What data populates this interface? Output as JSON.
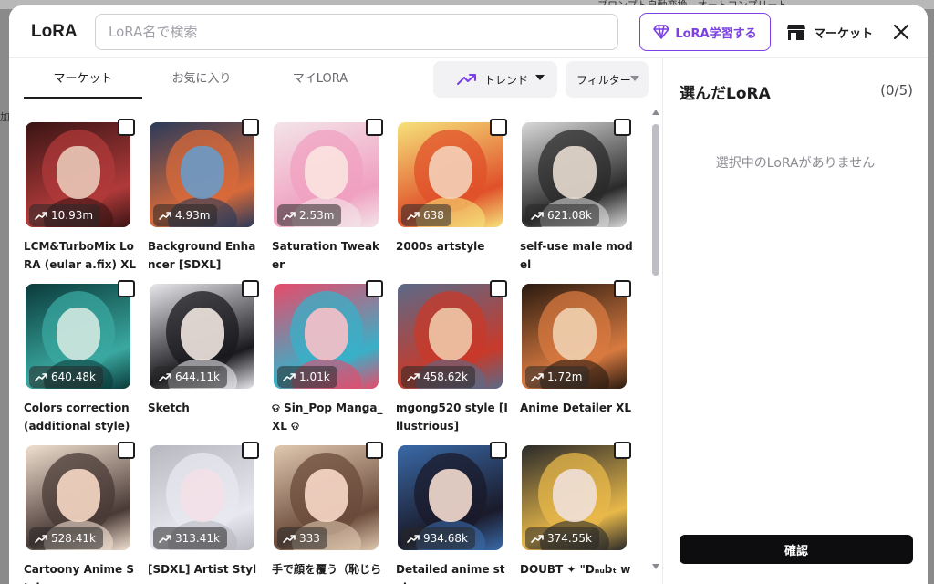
{
  "background": {
    "top_text": "プロンプト自動変換　オートコンプリート",
    "left_text": "加"
  },
  "header": {
    "title": "LoRA",
    "search_placeholder": "LoRA名で検索",
    "train_label": "LoRA学習する",
    "market_label": "マーケット",
    "accent_color": "#7b3fe4"
  },
  "tabs": [
    {
      "label": "マーケット",
      "active": true
    },
    {
      "label": "お気に入り",
      "active": false
    },
    {
      "label": "マイLORA",
      "active": false
    }
  ],
  "sort": {
    "label": "トレンド",
    "icon": "trending-up-icon"
  },
  "filter": {
    "label": "フィルター"
  },
  "cards": [
    {
      "name": "LCM&TurboMix LoRA (eular a.fix) XL",
      "count": "10.93m",
      "colors": [
        "#3a1414",
        "#b03a3a",
        "#e8c8b8"
      ]
    },
    {
      "name": "Background Enhancer [SDXL]",
      "count": "4.93m",
      "colors": [
        "#2a3a5a",
        "#d86a3a",
        "#6a9ac8"
      ]
    },
    {
      "name": "Saturation Tweaker",
      "count": "2.53m",
      "colors": [
        "#f3e4e8",
        "#f0a0c0",
        "#fbe4e0"
      ]
    },
    {
      "name": "2000s artstyle",
      "count": "638",
      "colors": [
        "#f6e27a",
        "#e0502a",
        "#f4d0b8"
      ]
    },
    {
      "name": "self-use male model",
      "count": "621.08k",
      "colors": [
        "#d8d8d8",
        "#2a2a2a",
        "#e8dcd0"
      ]
    },
    {
      "name": "Colors correction (additional style)",
      "count": "640.48k",
      "colors": [
        "#0a3a3a",
        "#3aa8a0",
        "#d0e8e0"
      ]
    },
    {
      "name": "Sketch",
      "count": "644.11k",
      "colors": [
        "#e8e8ec",
        "#1a1a1e",
        "#f0e6e0"
      ]
    },
    {
      "name": "ଡ Sin_Pop Manga_XL ଡ",
      "count": "1.01k",
      "colors": [
        "#e84a6a",
        "#38b0c8",
        "#f8c0c8"
      ]
    },
    {
      "name": "mgong520 style [Illustrious]",
      "count": "458.62k",
      "colors": [
        "#5a6a88",
        "#c83a2a",
        "#f0c8a8"
      ]
    },
    {
      "name": "Anime Detailer XL",
      "count": "1.72m",
      "colors": [
        "#2a1a10",
        "#d87a40",
        "#f0d0b0"
      ]
    },
    {
      "name": "Cartoony Anime Styl",
      "count": "528.41k",
      "colors": [
        "#f0e0d0",
        "#4a3a36",
        "#f6d8c4"
      ]
    },
    {
      "name": "[SDXL] Artist Style:",
      "count": "313.41k",
      "colors": [
        "#b8b8c0",
        "#e8e8f0",
        "#f4e0e8"
      ]
    },
    {
      "name": "手で顔を覆う（恥じら",
      "count": "333",
      "colors": [
        "#e0c8b0",
        "#6a4a3a",
        "#f8d8c8"
      ]
    },
    {
      "name": "Detailed anime style",
      "count": "934.68k",
      "colors": [
        "#3a6aa8",
        "#1a1a2a",
        "#f4dcd0"
      ]
    },
    {
      "name": "DOUBT ✦ \"Dₙᵤbₜ wₕᵢₛₚ",
      "count": "374.55k",
      "colors": [
        "#2a2a2a",
        "#e8b84a",
        "#f0e0d8"
      ]
    }
  ],
  "right_panel": {
    "title": "選んだLoRA",
    "count": "(0/5)",
    "empty_message": "選択中のLoRAがありません",
    "confirm_label": "確認"
  }
}
